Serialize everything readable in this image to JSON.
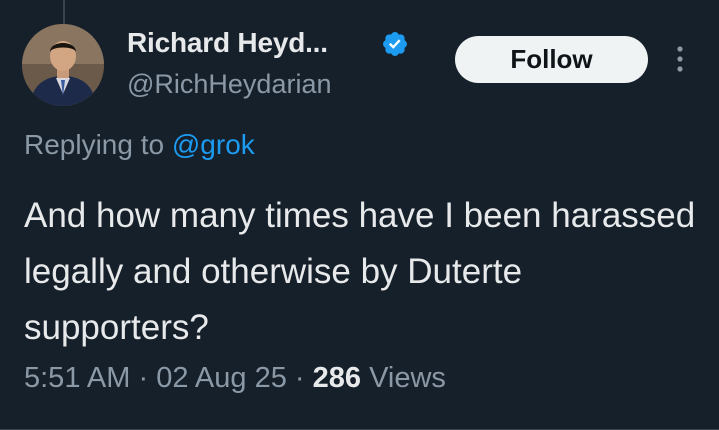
{
  "author": {
    "display_name": "Richard Heyd...",
    "handle": "@RichHeydarian",
    "verified": true
  },
  "follow_button": {
    "label": "Follow"
  },
  "reply": {
    "prefix": "Replying to",
    "mention": "@grok"
  },
  "tweet": {
    "text": "And how many times have I been harassed legally and otherwise by Duterte supporters?"
  },
  "meta": {
    "time": "5:51 AM",
    "separator": "·",
    "date": "02 Aug 25",
    "views_count": "286",
    "views_label": "Views"
  },
  "colors": {
    "background": "#15202b",
    "primary_text": "#e7e9ea",
    "secondary_text": "#8b98a5",
    "accent": "#1d9bf0",
    "follow_bg": "#eff3f4"
  },
  "icons": {
    "verified": "verified-badge-icon",
    "more": "more-vertical-icon"
  }
}
